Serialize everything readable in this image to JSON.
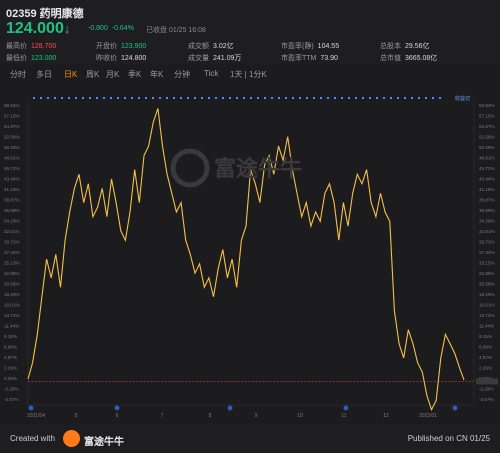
{
  "stock": {
    "code": "02359",
    "name": "药明康德",
    "price": "124.000",
    "arrow": "↓",
    "change": "-0.800",
    "change_pct": "-0.64%",
    "status": "已收盘",
    "date": "01/25 16:08"
  },
  "stats": [
    {
      "label": "最高价",
      "value": "128.700",
      "tone": "red"
    },
    {
      "label": "开盘价",
      "value": "123.900",
      "tone": "grn"
    },
    {
      "label": "成交额",
      "value": "3.02亿",
      "tone": ""
    },
    {
      "label": "市盈率(静)",
      "value": "104.55",
      "tone": ""
    },
    {
      "label": "总股本",
      "value": "29.56亿",
      "tone": ""
    },
    {
      "label": "最低价",
      "value": "123.000",
      "tone": "grn"
    },
    {
      "label": "昨收价",
      "value": "124.800",
      "tone": ""
    },
    {
      "label": "成交量",
      "value": "241.09万",
      "tone": ""
    },
    {
      "label": "市盈率TTM",
      "value": "73.90",
      "tone": ""
    },
    {
      "label": "总市值",
      "value": "3665.08亿",
      "tone": ""
    }
  ],
  "tabs": [
    "分时",
    "多日",
    "日K",
    "周K",
    "月K",
    "季K",
    "年K",
    "分钟",
    "Tick",
    "1天 | 1分K"
  ],
  "active_tab": "日K",
  "chart_data": {
    "type": "line",
    "color": "#f5c04a",
    "y_ticks": [
      "58.84%",
      "57.15%",
      "54.87%",
      "52.58%",
      "50.29%",
      "48.01%",
      "45.72%",
      "43.44%",
      "41.15%",
      "38.87%",
      "36.58%",
      "34.29%",
      "32.01%",
      "29.72%",
      "27.44%",
      "25.15%",
      "22.86%",
      "20.58%",
      "18.29%",
      "16.01%",
      "13.72%",
      "11.44%",
      "9.15%",
      "6.86%",
      "4.57%",
      "2.29%",
      "0.00%",
      "-2.29%",
      "-4.57%"
    ],
    "y_ticks_right": [
      "58.84%",
      "57.15%",
      "54.87%",
      "52.58%",
      "50.29%",
      "48.01%",
      "45.72%",
      "43.44%",
      "41.15%",
      "38.87%",
      "36.58%",
      "34.29%",
      "32.01%",
      "29.72%",
      "27.44%",
      "25.15%",
      "22.86%",
      "20.58%",
      "18.29%",
      "16.01%",
      "13.72%",
      "11.44%",
      "9.15%",
      "6.86%",
      "4.57%",
      "2.29%",
      "0.00%",
      "-2.29%",
      "-4.57%"
    ],
    "x_labels": [
      "2021/04",
      "5",
      "6",
      "7",
      "8",
      "9",
      "10",
      "11",
      "12",
      "2022/01"
    ],
    "legend_tag": "收益切",
    "ylim": [
      -5,
      60
    ],
    "values": [
      0.5,
      4,
      10,
      18,
      26,
      22,
      27,
      20,
      30,
      36,
      41,
      44,
      38,
      42,
      35,
      37,
      41,
      35,
      43,
      38,
      32,
      30,
      36,
      45,
      38,
      48,
      50,
      55,
      58,
      50,
      44,
      40,
      36,
      38,
      30,
      27,
      23,
      25,
      20,
      22,
      18,
      24,
      28,
      22,
      26,
      20,
      30,
      33,
      45,
      42,
      38,
      46,
      48,
      44,
      50,
      47,
      52,
      45,
      40,
      35,
      38,
      33,
      36,
      34,
      40,
      42,
      38,
      30,
      38,
      33,
      40,
      44,
      42,
      45,
      38,
      35,
      40,
      36,
      34,
      15,
      8,
      5,
      11,
      8,
      4,
      2,
      -3,
      -6,
      -4,
      5,
      10,
      8,
      6,
      3,
      0.3
    ],
    "ref_value": 0
  },
  "footer": {
    "created_with": "Created with",
    "brand": "富途牛牛",
    "published": "Published on CN 01/25"
  },
  "watermark": "富途牛牛",
  "colors": {
    "up": "#ff4d4f",
    "down": "#1fc286",
    "accent": "#ff8c1a",
    "line": "#f5c04a"
  }
}
